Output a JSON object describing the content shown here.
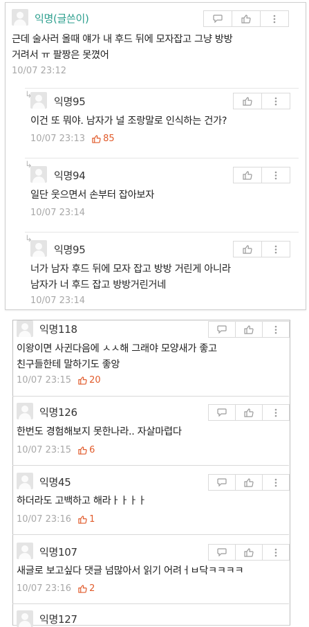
{
  "comments": [
    {
      "name": "익명(글쓴이)",
      "body": [
        "근데 술사러 올때 얘가 내 후드 뒤에 모자잡고 그냥 방방",
        "거려서 ㅠ 팔짱은 못꼈어"
      ],
      "time": "10/07 23:12",
      "likes": ""
    },
    {
      "name": "익명95",
      "body": [
        "이건 또 뭐야. 남자가 널 조랑말로 인식하는 건가?"
      ],
      "time": "10/07 23:13",
      "likes": "85"
    },
    {
      "name": "익명94",
      "body": [
        "일단 웃으면서 손부터 잡아보자"
      ],
      "time": "10/07 23:14",
      "likes": ""
    },
    {
      "name": "익명95",
      "body": [
        "너가 남자 후드 뒤에 모자 잡고 방방 거린게 아니라",
        "남자가 너 후드 잡고 방방거린거네"
      ],
      "time": "10/07 23:14",
      "likes": ""
    },
    {
      "name": "익명118",
      "body": [
        "이왕이면 사귄다음에 ㅅㅅ해 그래야 모양새가 좋고",
        "친구들한테 말하기도 좋앙"
      ],
      "time": "10/07 23:15",
      "likes": "20"
    },
    {
      "name": "익명126",
      "body": [
        "한번도 경험해보지 못한나라.. 자살마렵다"
      ],
      "time": "10/07 23:15",
      "likes": "6"
    },
    {
      "name": "익명45",
      "body": [
        "하더라도 고백하고 해라ㅏㅏㅏㅏ"
      ],
      "time": "10/07 23:16",
      "likes": "1"
    },
    {
      "name": "익명107",
      "body": [
        "새글로 보고싶다 댓글 넘많아서 읽기 어려ㅓㅂ닥ㅋㅋㅋㅋ"
      ],
      "time": "10/07 23:16",
      "likes": "2"
    },
    {
      "name": "익명127",
      "body": [],
      "time": "",
      "likes": ""
    }
  ],
  "icons": {
    "reply": "speech-bubble-icon",
    "like": "thumbs-up-icon",
    "more": "vertical-dots-icon",
    "reply_indent": "reply-arrow-icon"
  },
  "colors": {
    "op_name": "#2b9e8d",
    "likes": "#e15b2b",
    "timestamp": "#a8a8a8"
  }
}
